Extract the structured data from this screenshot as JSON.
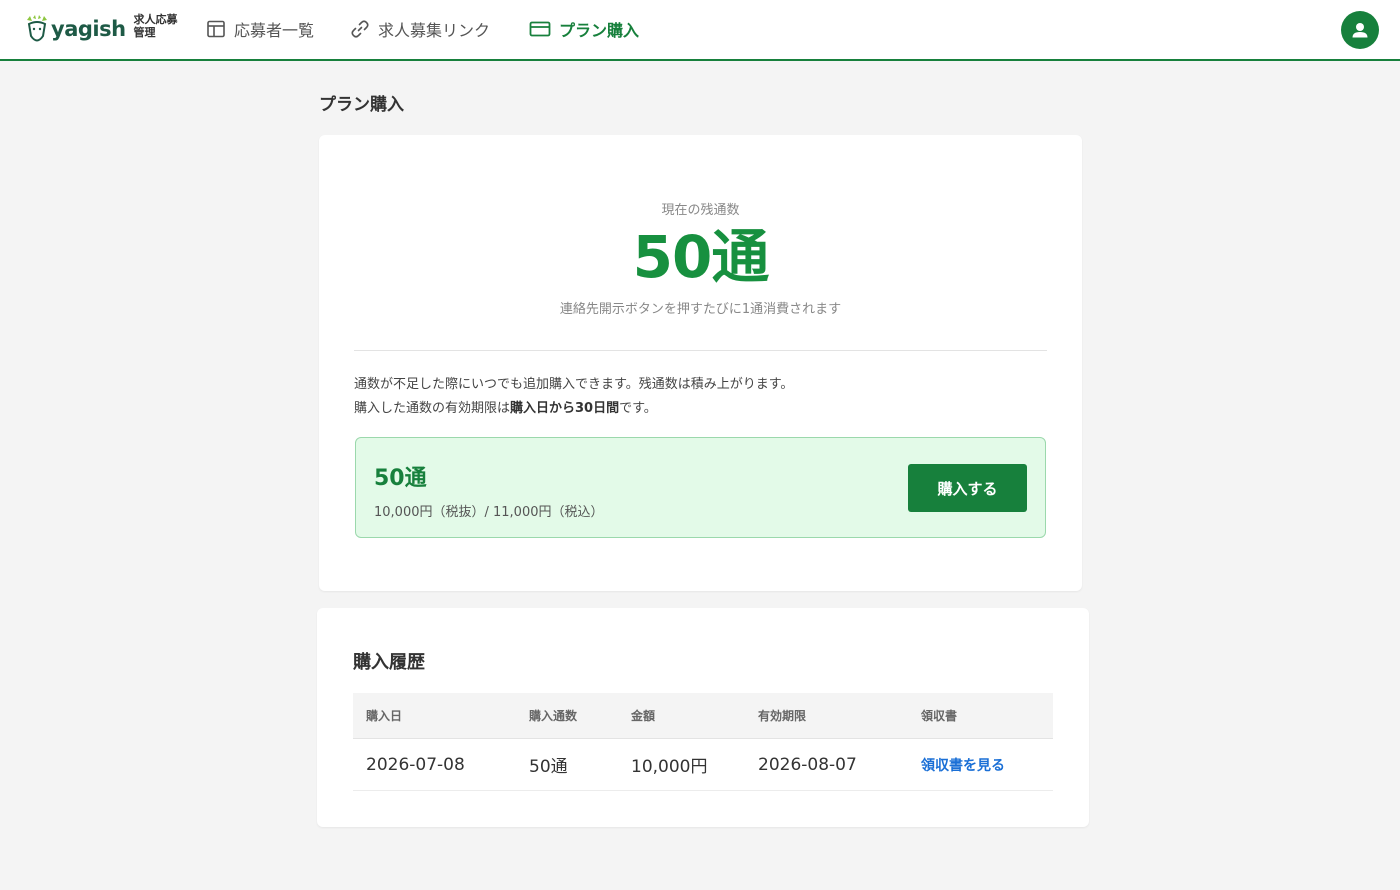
{
  "header": {
    "logo_text": "yagish",
    "logo_sub_1": "求人応募",
    "logo_sub_2": "管理",
    "nav": [
      {
        "label": "応募者一覧",
        "icon": "layout-icon"
      },
      {
        "label": "求人募集リンク",
        "icon": "link-icon"
      },
      {
        "label": "プラン購入",
        "icon": "credit-card-icon",
        "active": true
      }
    ],
    "avatar_icon": "user-icon"
  },
  "page": {
    "title": "プラン購入"
  },
  "remaining": {
    "label": "現在の残通数",
    "value": "50通",
    "note": "連絡先開示ボタンを押すたびに1通消費されます"
  },
  "description": {
    "line1": "通数が不足した際にいつでも追加購入できます。残通数は積み上がります。",
    "line2_prefix": "購入した通数の有効期限は",
    "line2_bold": "購入日から30日間",
    "line2_suffix": "です。"
  },
  "plan": {
    "name": "50通",
    "price": "10,000円（税抜）/ 11,000円（税込）",
    "buy_label": "購入する"
  },
  "history": {
    "title": "購入履歴",
    "columns": [
      "購入日",
      "購入通数",
      "金額",
      "有効期限",
      "領収書"
    ],
    "rows": [
      {
        "date": "2026-07-08",
        "count": "50通",
        "amount": "10,000円",
        "expires": "2026-08-07",
        "receipt": "領収書を見る"
      }
    ]
  },
  "colors": {
    "brand": "#17803c",
    "accent_text": "#17903f",
    "plan_bg": "#e3fae8",
    "link": "#1a6fd6"
  }
}
